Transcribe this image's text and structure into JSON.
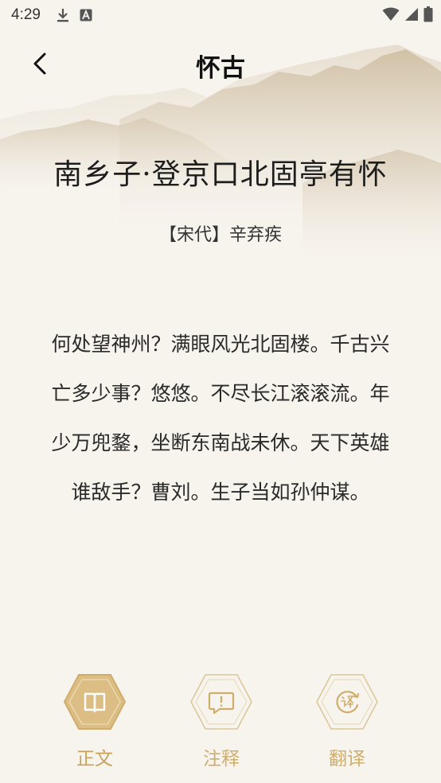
{
  "status_bar": {
    "time": "4:29",
    "left_icons": [
      "download-icon",
      "font-a-icon"
    ],
    "right_icons": [
      "wifi-icon",
      "signal-icon",
      "battery-icon"
    ]
  },
  "header": {
    "title": "怀古"
  },
  "poem": {
    "title": "南乡子·登京口北固亭有怀",
    "author": "【宋代】辛弃疾",
    "lines": [
      "何处望神州？满眼风光北固楼。千古兴",
      "亡多少事？悠悠。不尽长江滚滚流。年",
      "少万兜鍪，坐断东南战未休。天下英雄",
      "谁敌手？曹刘。生子当如孙仲谋。"
    ]
  },
  "bottom_nav": {
    "items": [
      {
        "label": "正文",
        "icon": "book-icon",
        "active": true
      },
      {
        "label": "注释",
        "icon": "comment-icon",
        "active": false
      },
      {
        "label": "翻译",
        "icon": "translate-icon",
        "active": false
      }
    ]
  },
  "colors": {
    "accent": "#d8b97c",
    "accent_text": "#c9a25a",
    "background": "#f7f4ee"
  }
}
